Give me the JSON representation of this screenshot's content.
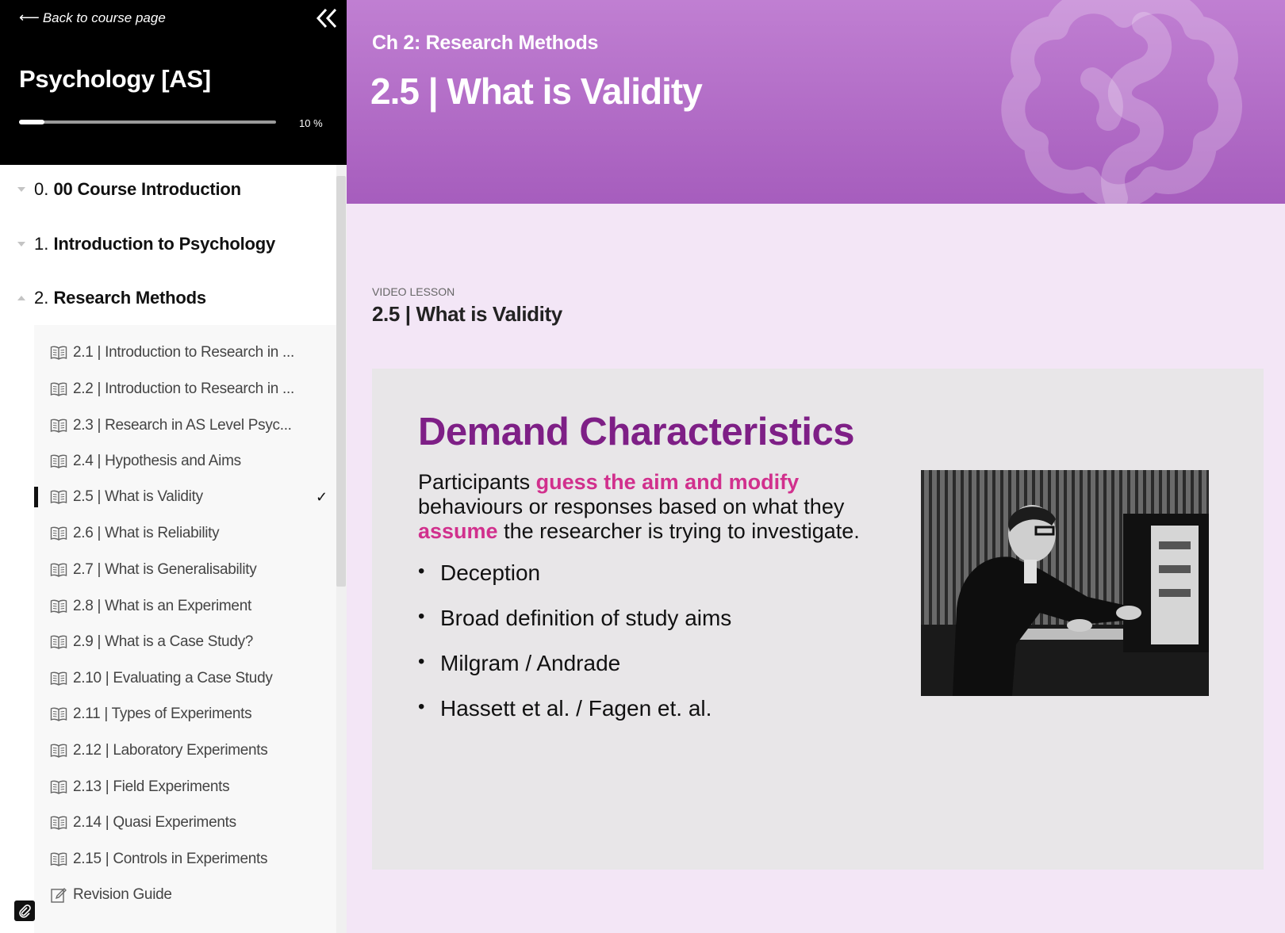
{
  "sidebar": {
    "back_label": "Back to course page",
    "course_title": "Psychology [AS]",
    "progress": {
      "percent_label": "10 %",
      "value": 0.1
    },
    "sections": [
      {
        "num": "0.",
        "title": "00 Course Introduction"
      },
      {
        "num": "1.",
        "title": "Introduction to Psychology"
      },
      {
        "num": "2.",
        "title": "Research Methods"
      }
    ],
    "lessons": [
      {
        "label": "2.1 | Introduction to Research in ..."
      },
      {
        "label": "2.2 | Introduction to Research in ..."
      },
      {
        "label": "2.3 | Research in AS Level Psyc..."
      },
      {
        "label": "2.4 | Hypothesis and Aims"
      },
      {
        "label": "2.5 | What is Validity",
        "active": true,
        "check": "✓"
      },
      {
        "label": "2.6 | What is Reliability"
      },
      {
        "label": "2.7 | What is Generalisability"
      },
      {
        "label": "2.8 | What is an Experiment"
      },
      {
        "label": "2.9 | What is a Case Study?"
      },
      {
        "label": "2.10 | Evaluating a Case Study"
      },
      {
        "label": "2.11 | Types of Experiments"
      },
      {
        "label": "2.12 | Laboratory Experiments"
      },
      {
        "label": "2.13 | Field Experiments"
      },
      {
        "label": "2.14 | Quasi Experiments"
      },
      {
        "label": "2.15 | Controls in Experiments"
      },
      {
        "label": "Revision Guide",
        "icon": "edit"
      }
    ]
  },
  "banner": {
    "chapter": "Ch 2: Research Methods",
    "title": "2.5 | What is Validity"
  },
  "lesson": {
    "type": "VIDEO LESSON",
    "title": "2.5 | What is Validity"
  },
  "slide": {
    "title": "Demand Characteristics",
    "para_1": "Participants ",
    "para_hl_1": "guess the aim and modify",
    "para_2": " behaviours or responses based on what they ",
    "para_hl_2": "assume",
    "para_3": " the researcher is trying to investigate.",
    "bullets": [
      "Deception",
      "Broad definition of study aims",
      "Milgram / Andrade",
      "Hassett et al. / Fagen et. al."
    ]
  },
  "colors": {
    "banner_top": "#c07fd2",
    "banner_bottom": "#a65dbd",
    "slide_title": "#7e1f86",
    "highlight": "#d1308d",
    "page_bg": "#f3e6f6"
  }
}
